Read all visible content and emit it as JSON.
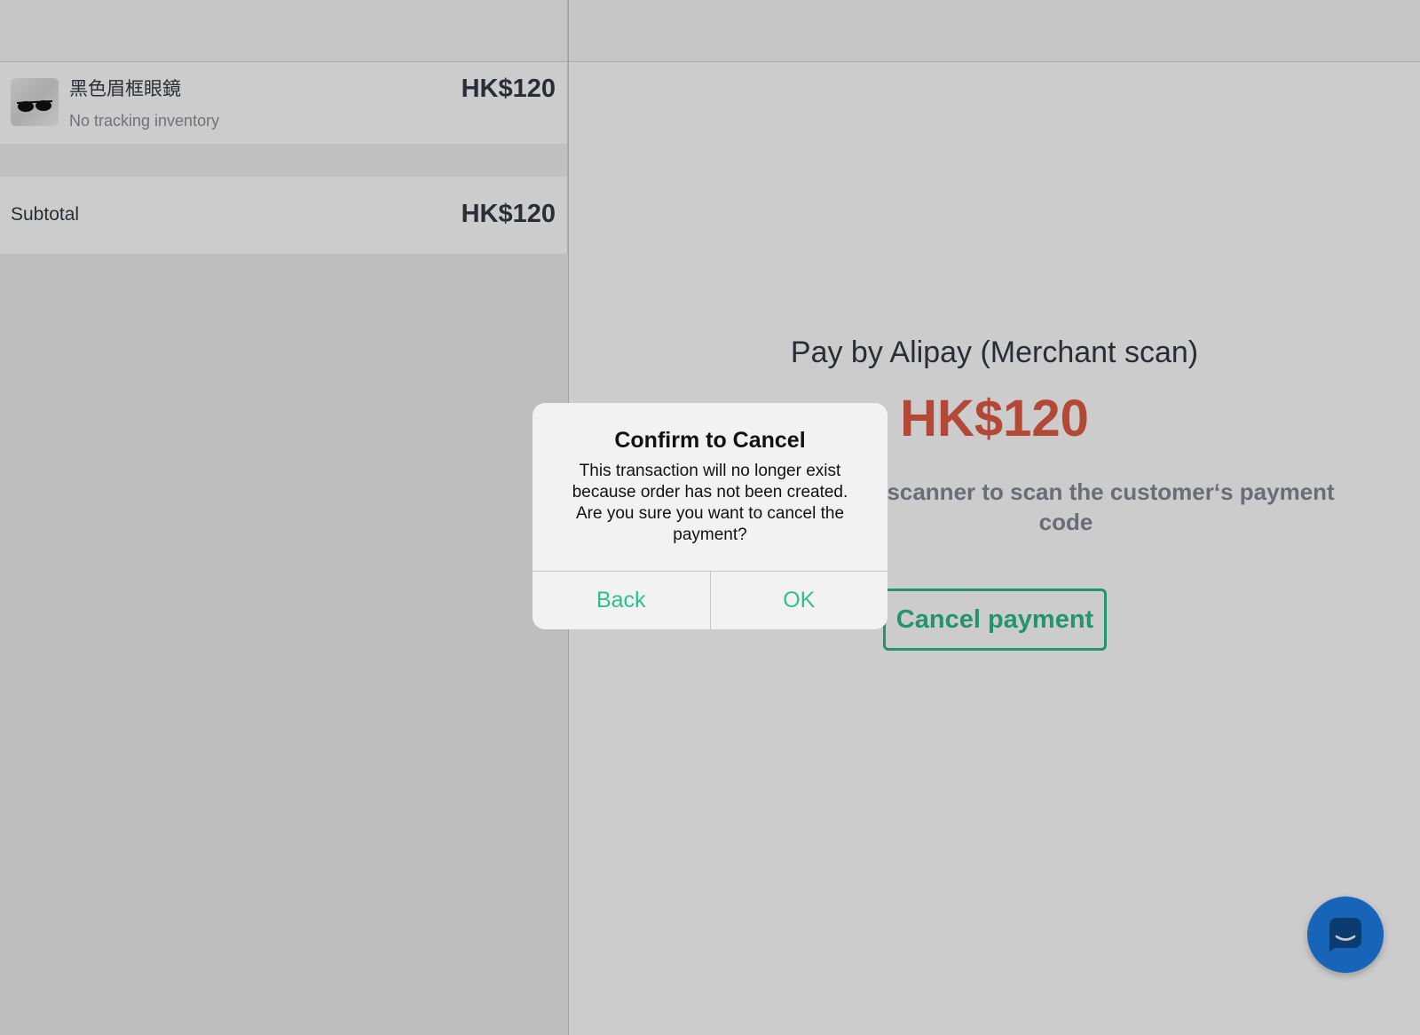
{
  "cart": {
    "items": [
      {
        "name": "黑色眉框眼鏡",
        "subtitle": "No tracking inventory",
        "price": "HK$120",
        "thumbnail_icon": "sunglasses-icon"
      }
    ],
    "subtotal_label": "Subtotal",
    "subtotal_value": "HK$120"
  },
  "payment": {
    "title": "Pay by Alipay (Merchant scan)",
    "amount": "HK$120",
    "instruction": "Use the scanner to scan the customer‘s payment code",
    "cancel_label": "Cancel payment"
  },
  "dialog": {
    "title": "Confirm to Cancel",
    "message": "This transaction will no longer exist because order has not been created. Are you sure you want to cancel the payment?",
    "back_label": "Back",
    "ok_label": "OK"
  },
  "chat": {
    "icon": "chat-bubble-icon"
  },
  "colors": {
    "accent": "#2fb88a",
    "amount": "#e05a45",
    "fab": "#1f7ee8"
  }
}
